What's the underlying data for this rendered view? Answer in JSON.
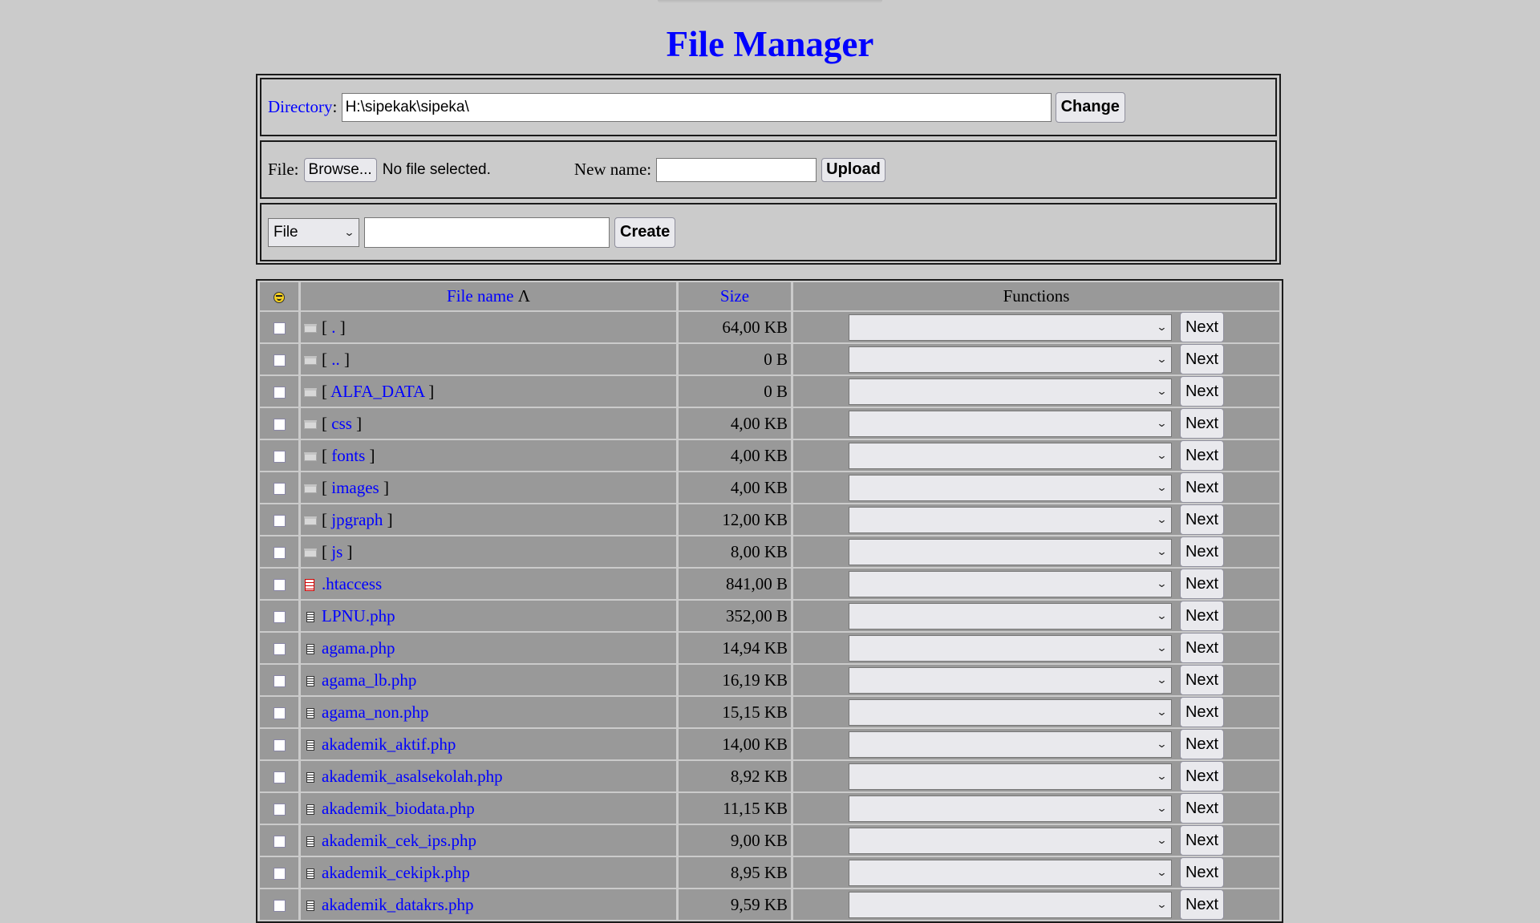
{
  "page_title": "File Manager",
  "directory": {
    "label": "Directory",
    "value": "H:\\sipekak\\sipeka\\",
    "button": "Change"
  },
  "upload": {
    "file_label": "File:",
    "browse_button": "Browse...",
    "file_status": "No file selected.",
    "new_name_label": "New name:",
    "new_name_value": "",
    "button": "Upload"
  },
  "create": {
    "type_selected": "File",
    "name_value": "",
    "button": "Create"
  },
  "table": {
    "headers": {
      "icon": "smiley-icon",
      "name": "File name",
      "sort_indicator": "Λ",
      "size": "Size",
      "functions": "Functions"
    },
    "next_label": "Next",
    "rows": [
      {
        "type": "folder",
        "name": ".",
        "size": "64,00 KB"
      },
      {
        "type": "folder",
        "name": "..",
        "size": "0 B"
      },
      {
        "type": "folder",
        "name": "ALFA_DATA",
        "size": "0 B"
      },
      {
        "type": "folder",
        "name": "css",
        "size": "4,00 KB"
      },
      {
        "type": "folder",
        "name": "fonts",
        "size": "4,00 KB"
      },
      {
        "type": "folder",
        "name": "images",
        "size": "4,00 KB"
      },
      {
        "type": "folder",
        "name": "jpgraph",
        "size": "12,00 KB"
      },
      {
        "type": "folder",
        "name": "js",
        "size": "8,00 KB"
      },
      {
        "type": "special-file",
        "name": ".htaccess",
        "size": "841,00 B"
      },
      {
        "type": "file",
        "name": "LPNU.php",
        "size": "352,00 B"
      },
      {
        "type": "file",
        "name": "agama.php",
        "size": "14,94 KB"
      },
      {
        "type": "file",
        "name": "agama_lb.php",
        "size": "16,19 KB"
      },
      {
        "type": "file",
        "name": "agama_non.php",
        "size": "15,15 KB"
      },
      {
        "type": "file",
        "name": "akademik_aktif.php",
        "size": "14,00 KB"
      },
      {
        "type": "file",
        "name": "akademik_asalsekolah.php",
        "size": "8,92 KB"
      },
      {
        "type": "file",
        "name": "akademik_biodata.php",
        "size": "11,15 KB"
      },
      {
        "type": "file",
        "name": "akademik_cek_ips.php",
        "size": "9,00 KB"
      },
      {
        "type": "file",
        "name": "akademik_cekipk.php",
        "size": "8,95 KB"
      },
      {
        "type": "file",
        "name": "akademik_datakrs.php",
        "size": "9,59 KB"
      }
    ]
  }
}
